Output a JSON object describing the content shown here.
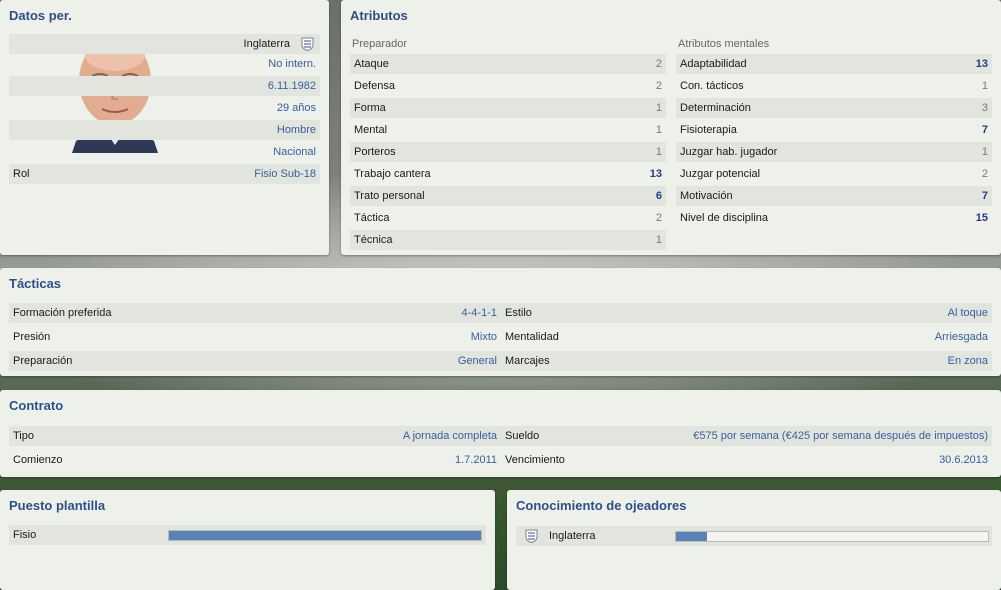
{
  "personal": {
    "title": "Datos per.",
    "nationality": "Inglaterra",
    "rows": [
      {
        "value": "No intern."
      },
      {
        "value": "6.11.1982"
      },
      {
        "value": "29 años"
      },
      {
        "value": "Hombre"
      },
      {
        "value": "Nacional"
      }
    ],
    "role_label": "Rol",
    "role_value": "Fisio Sub-18",
    "flag_icon": "england-flag-icon"
  },
  "attributes": {
    "title": "Atributos",
    "coach_header": "Preparador",
    "coach": [
      {
        "label": "Ataque",
        "value": "2"
      },
      {
        "label": "Defensa",
        "value": "2"
      },
      {
        "label": "Forma",
        "value": "1"
      },
      {
        "label": "Mental",
        "value": "1"
      },
      {
        "label": "Porteros",
        "value": "1"
      },
      {
        "label": "Trabajo cantera",
        "value": "13"
      },
      {
        "label": "Trato personal",
        "value": "6"
      },
      {
        "label": "Táctica",
        "value": "2"
      },
      {
        "label": "Técnica",
        "value": "1"
      }
    ],
    "mental_header": "Atributos mentales",
    "mental": [
      {
        "label": "Adaptabilidad",
        "value": "13"
      },
      {
        "label": "Con. tácticos",
        "value": "1"
      },
      {
        "label": "Determinación",
        "value": "3"
      },
      {
        "label": "Fisioterapia",
        "value": "7"
      },
      {
        "label": "Juzgar hab. jugador",
        "value": "1"
      },
      {
        "label": "Juzgar potencial",
        "value": "2"
      },
      {
        "label": "Motivación",
        "value": "7"
      },
      {
        "label": "Nivel de disciplina",
        "value": "15"
      }
    ]
  },
  "tactics": {
    "title": "Tácticas",
    "left": [
      {
        "label": "Formación preferida",
        "value": "4-4-1-1"
      },
      {
        "label": "Presión",
        "value": "Mixto"
      },
      {
        "label": "Preparación",
        "value": "General"
      }
    ],
    "right": [
      {
        "label": "Estilo",
        "value": "Al toque"
      },
      {
        "label": "Mentalidad",
        "value": "Arriesgada"
      },
      {
        "label": "Marcajes",
        "value": "En zona"
      }
    ]
  },
  "contract": {
    "title": "Contrato",
    "left": [
      {
        "label": "Tipo",
        "value": "A jornada completa"
      },
      {
        "label": "Comienzo",
        "value": "1.7.2011"
      }
    ],
    "right": [
      {
        "label": "Sueldo",
        "value": "€575 por semana (€425 por semana después de impuestos)"
      },
      {
        "label": "Vencimiento",
        "value": "30.6.2013"
      }
    ]
  },
  "squad": {
    "title": "Puesto plantilla",
    "label": "Fisio",
    "level": 1.0
  },
  "scouting": {
    "title": "Conocimiento de ojeadores",
    "label": "Inglaterra",
    "level": 0.1
  },
  "colors": {
    "accent": "#2d4f8a",
    "value_text": "#35609e",
    "bar_fill": "#5a82b6"
  }
}
